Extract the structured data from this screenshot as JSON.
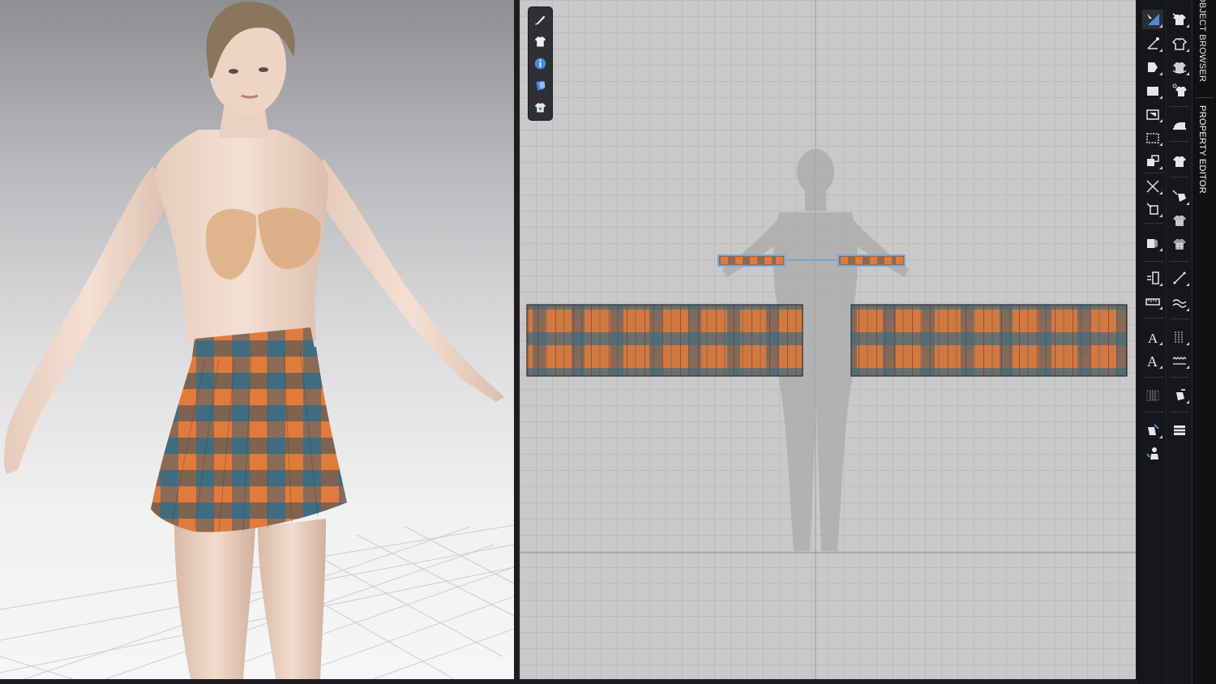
{
  "side_tabs": {
    "object_browser": "OBJECT BROWSER",
    "property_editor": "PROPERTY EDITOR"
  },
  "colors": {
    "plaid_orange": "#e07b3c",
    "plaid_teal": "#3f6c80",
    "plaid_brown": "#8a6956",
    "skin": "#efd7c8",
    "selection_blue": "#7aa7d8",
    "toolbar_bg": "#16171a"
  },
  "icons": {
    "mini_toolbar": [
      "needle-pen-icon",
      "garment-tshirt-icon",
      "info-icon",
      "fabric-swatch-icon",
      "avatar-shirt-icon"
    ],
    "toolbar_col1": [
      "select-transform-icon",
      "edit-pattern-icon",
      "transform-pattern-icon",
      "rectangle-icon",
      "polygon-icon",
      "internal-rectangle-icon",
      "trace-icon",
      "edit-curve-icon",
      "add-point-icon",
      "fold-icon",
      "segment-icon",
      "ruler-icon",
      "text-icon",
      "text-edit-icon",
      "pleat-icon",
      "pin-icon",
      "avatar-pin-icon"
    ],
    "toolbar_col2": [
      "simulate-icon",
      "simulate-segment-icon",
      "simulate-free-icon",
      "simulate-point-icon",
      "iron-icon",
      "tshirt-settings-icon",
      "fold-arrange-icon",
      "fit-icon",
      "mesh-icon",
      "seam-line-icon",
      "topstitch-icon",
      "zigzag-icon",
      "zipper-icon",
      "tack-icon",
      "shirring-icon"
    ]
  }
}
